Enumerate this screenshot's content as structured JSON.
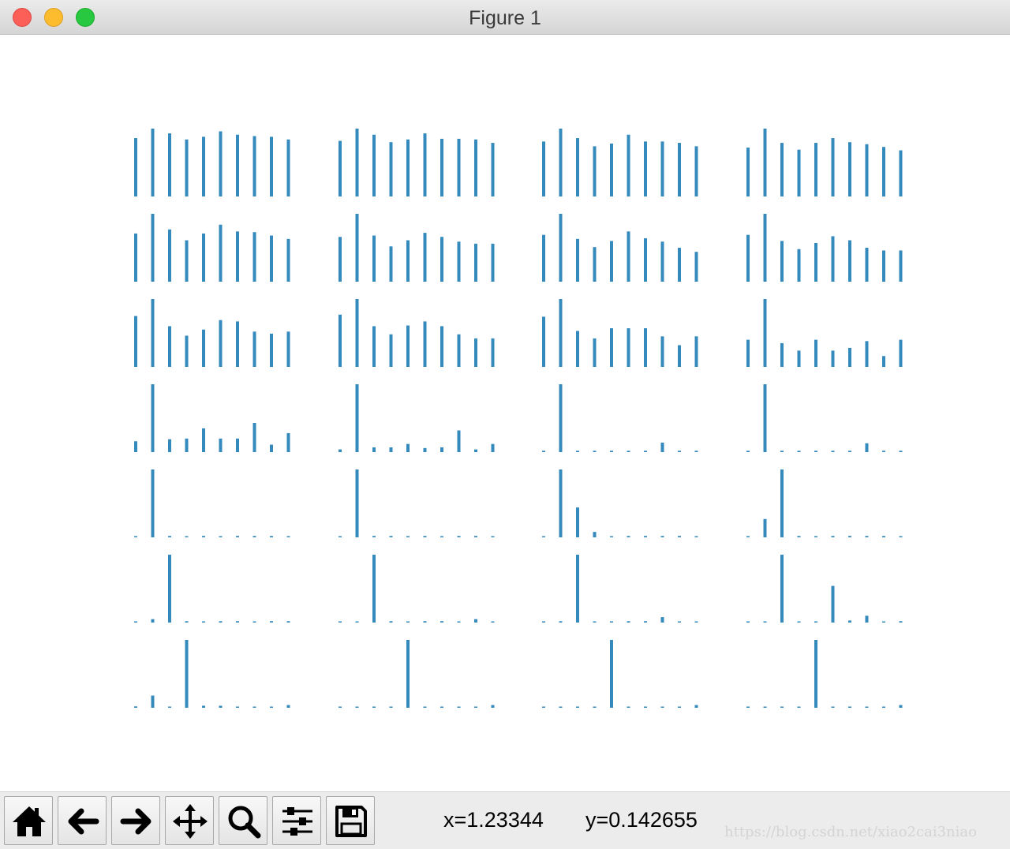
{
  "window": {
    "title": "Figure 1"
  },
  "toolbar": {
    "buttons": [
      {
        "name": "home-button",
        "icon": "home-icon"
      },
      {
        "name": "back-button",
        "icon": "arrow-left-icon"
      },
      {
        "name": "forward-button",
        "icon": "arrow-right-icon"
      },
      {
        "name": "pan-button",
        "icon": "move-icon"
      },
      {
        "name": "zoom-button",
        "icon": "magnifier-icon"
      },
      {
        "name": "subplots-button",
        "icon": "sliders-icon"
      },
      {
        "name": "save-button",
        "icon": "floppy-disk-icon"
      }
    ],
    "x_readout": "x=1.23344",
    "y_readout": "y=0.142655"
  },
  "watermark": "https://blog.csdn.net/xiao2cai3niao",
  "colors": {
    "bar": "#348abd"
  },
  "chart_data": {
    "type": "bar",
    "layout": "7 rows x 4 columns grid of bar subplots, axes hidden",
    "subplots": [
      {
        "values": [
          0.86,
          1,
          0.93,
          0.84,
          0.88,
          0.96,
          0.91,
          0.89,
          0.88,
          0.84
        ]
      },
      {
        "values": [
          0.82,
          1,
          0.91,
          0.8,
          0.84,
          0.93,
          0.85,
          0.85,
          0.84,
          0.79
        ]
      },
      {
        "values": [
          0.81,
          1,
          0.86,
          0.74,
          0.78,
          0.91,
          0.81,
          0.81,
          0.79,
          0.74
        ]
      },
      {
        "values": [
          0.72,
          1,
          0.79,
          0.69,
          0.79,
          0.86,
          0.8,
          0.77,
          0.73,
          0.68
        ]
      },
      {
        "values": [
          0.71,
          1,
          0.77,
          0.61,
          0.71,
          0.84,
          0.74,
          0.73,
          0.68,
          0.63
        ]
      },
      {
        "values": [
          0.66,
          1,
          0.68,
          0.52,
          0.61,
          0.72,
          0.66,
          0.59,
          0.56,
          0.56
        ]
      },
      {
        "values": [
          0.69,
          1,
          0.63,
          0.51,
          0.6,
          0.74,
          0.64,
          0.59,
          0.5,
          0.44
        ]
      },
      {
        "values": [
          0.69,
          1,
          0.6,
          0.48,
          0.57,
          0.67,
          0.61,
          0.5,
          0.46,
          0.46
        ]
      },
      {
        "values": [
          0.75,
          1,
          0.6,
          0.46,
          0.55,
          0.69,
          0.67,
          0.52,
          0.49,
          0.52
        ]
      },
      {
        "values": [
          0.77,
          1,
          0.6,
          0.48,
          0.61,
          0.67,
          0.6,
          0.48,
          0.42,
          0.42
        ]
      },
      {
        "values": [
          0.74,
          1,
          0.53,
          0.42,
          0.57,
          0.57,
          0.57,
          0.45,
          0.32,
          0.45
        ]
      },
      {
        "values": [
          0.4,
          1,
          0.35,
          0.24,
          0.4,
          0.24,
          0.28,
          0.38,
          0.16,
          0.4
        ]
      },
      {
        "values": [
          0.16,
          1,
          0.19,
          0.2,
          0.35,
          0.2,
          0.2,
          0.43,
          0.11,
          0.28
        ]
      },
      {
        "values": [
          0.04,
          1,
          0.07,
          0.07,
          0.12,
          0.06,
          0.07,
          0.32,
          0.04,
          0.12
        ]
      },
      {
        "values": [
          0.02,
          1,
          0.02,
          0.02,
          0.02,
          0.02,
          0.02,
          0.14,
          0.02,
          0.02
        ]
      },
      {
        "values": [
          0.02,
          1,
          0.02,
          0.02,
          0.02,
          0.02,
          0.02,
          0.13,
          0.02,
          0.02
        ]
      },
      {
        "values": [
          0,
          1,
          0.02,
          0,
          0.02,
          0,
          0.02,
          0.02,
          0.02,
          0
        ]
      },
      {
        "values": [
          0,
          1,
          0.02,
          0.02,
          0,
          0.02,
          0,
          0.02,
          0.02,
          0
        ]
      },
      {
        "values": [
          0.01,
          1,
          0.44,
          0.08,
          0,
          0.02,
          0.02,
          0.02,
          0.02,
          0
        ]
      },
      {
        "values": [
          0.01,
          0.27,
          1,
          0.02,
          0,
          0.02,
          0.02,
          0.02,
          0.02,
          0
        ]
      },
      {
        "values": [
          0.01,
          0.05,
          1,
          0.02,
          0,
          0.02,
          0.02,
          0,
          0.02,
          0.02
        ]
      },
      {
        "values": [
          0,
          0.01,
          1,
          0.02,
          0,
          0.02,
          0.02,
          0,
          0.05,
          0.01
        ]
      },
      {
        "values": [
          0.01,
          0.02,
          1,
          0.01,
          0,
          0.02,
          0.02,
          0.08,
          0.01,
          0.01
        ]
      },
      {
        "values": [
          0.01,
          0.01,
          1,
          0,
          0.01,
          0.54,
          0.03,
          0.1,
          0.01,
          0.02
        ]
      },
      {
        "values": [
          0.02,
          0.18,
          0.01,
          1,
          0.03,
          0.03,
          0.01,
          0.01,
          0.01,
          0.04
        ]
      },
      {
        "values": [
          0.01,
          0.01,
          0.01,
          0.01,
          1,
          0.01,
          0.01,
          0.01,
          0.01,
          0.04
        ]
      },
      {
        "values": [
          0.01,
          0.01,
          0.01,
          0.01,
          1,
          0.01,
          0.01,
          0.01,
          0.01,
          0.04
        ]
      },
      {
        "values": [
          0.01,
          0.01,
          0.01,
          0.01,
          1,
          0.01,
          0.01,
          0.01,
          0.01,
          0.04
        ]
      }
    ]
  }
}
